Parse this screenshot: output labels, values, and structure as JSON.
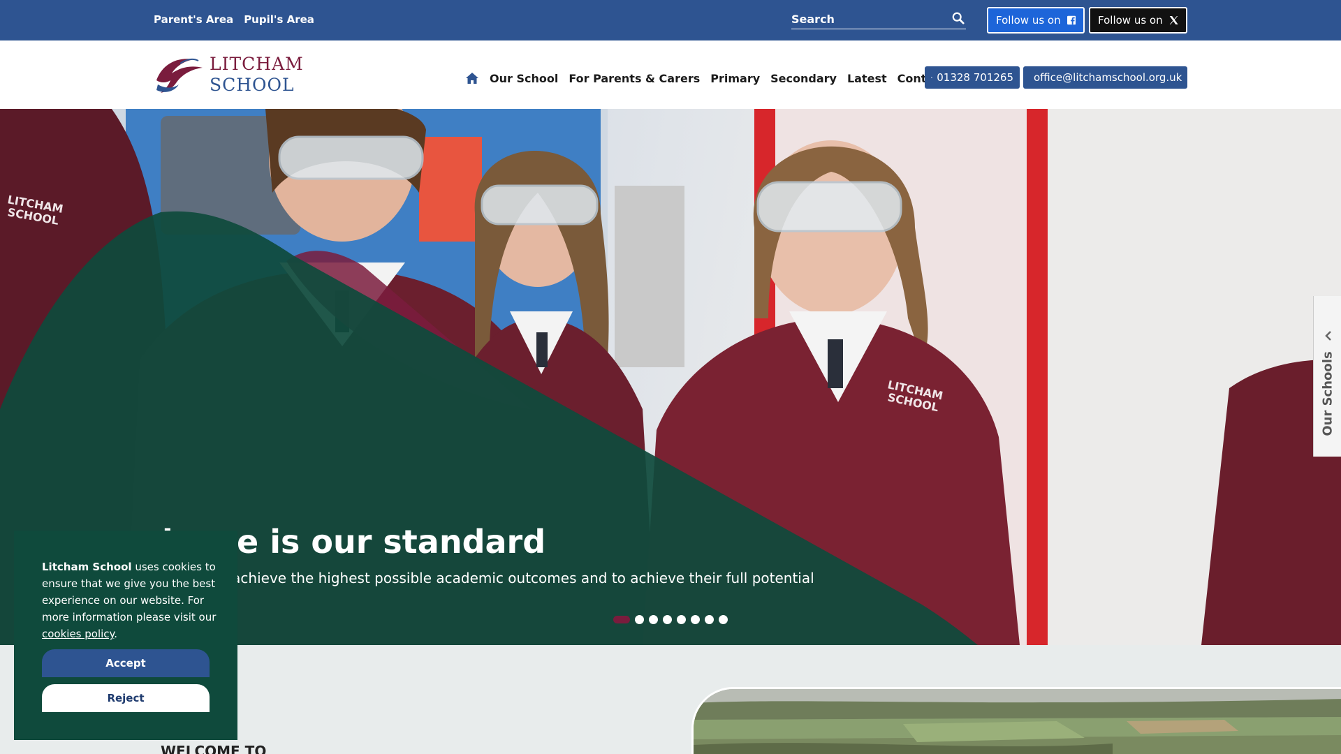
{
  "topbar": {
    "links": [
      "Parent's Area",
      "Pupil's Area"
    ],
    "search_placeholder": "Search",
    "follow_facebook": "Follow us on",
    "follow_x": "Follow us on"
  },
  "header": {
    "logo_line1": "LITCHAM",
    "logo_line2": "SCHOOL",
    "nav": [
      "Our School",
      "For Parents & Carers",
      "Primary",
      "Secondary",
      "Latest",
      "Contact"
    ],
    "phone": "01328 701265",
    "email": "office@litchamschool.org.uk"
  },
  "hero": {
    "title": "lence is our standard",
    "subtitle": "y pupil to achieve the highest possible academic outcomes and to achieve their full potential",
    "slide_count": 8,
    "active_slide": 1
  },
  "side_tab": {
    "label": "Our Schools"
  },
  "cookie": {
    "org": "Litcham School",
    "text_before": " uses cookies to ensure that we give you the best experience on our website. For more information please visit our ",
    "link": "cookies policy",
    "text_after": ".",
    "accept": "Accept",
    "reject": "Reject"
  },
  "below": {
    "heading": "WELCOME TO"
  },
  "colors": {
    "brand_blue": "#2e5491",
    "brand_maroon": "#7a1c3d",
    "hero_green": "#0f4a3c",
    "facebook_blue": "#1d65d9"
  }
}
